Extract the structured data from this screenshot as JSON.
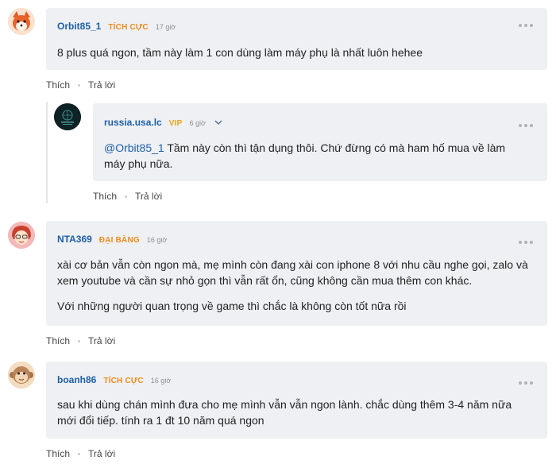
{
  "comments": [
    {
      "username": "Orbit85_1",
      "badge": "TÍCH CỰC",
      "time": "17 giờ",
      "text": "8 plus quá ngon, tầm này làm 1 con dùng làm máy phụ là nhất luôn hehee",
      "like_label": "Thích",
      "reply_label": "Trả lời"
    },
    {
      "username": "russia.usa.lc",
      "badge": "VIP",
      "time": "6 giờ",
      "mention": "@Orbit85_1",
      "text": " Tầm này còn thì tận dụng thôi. Chứ đừng có mà ham hố mua về làm máy phụ nữa.",
      "like_label": "Thích",
      "reply_label": "Trả lời"
    },
    {
      "username": "NTA369",
      "badge": "ĐẠI BÀNG",
      "time": "16 giờ",
      "text": "xài cơ bản vẫn còn ngon mà, mẹ mình còn đang xài con iphone 8 với nhu cầu nghe gọi, zalo và xem youtube và cần sự nhỏ gọn thì vẫn rất ổn, cũng không cần mua thêm con khác.",
      "text2": "Với những người quan trọng về game thì chắc là không còn tốt nữa rồi",
      "like_label": "Thích",
      "reply_label": "Trả lời"
    },
    {
      "username": "boanh86",
      "badge": "TÍCH CỰC",
      "time": "16 giờ",
      "text": "sau khi dùng chán mình đưa cho mẹ mình vẫn vẫn ngon lành. chắc dùng thêm 3-4 năm nữa mới đổi tiếp. tính ra 1 đt 10 năm quá ngon",
      "like_label": "Thích",
      "reply_label": "Trả lời"
    }
  ],
  "colors": {
    "username": "#1f5fa8",
    "badge_active": "#f08a1c",
    "badge_vip": "#e8a41a",
    "bubble": "#eef0f3"
  },
  "icons": [
    "avatar-fox",
    "avatar-dark-logo",
    "avatar-redhead",
    "avatar-monkey",
    "more-dots-icon",
    "chevron-down-icon"
  ]
}
